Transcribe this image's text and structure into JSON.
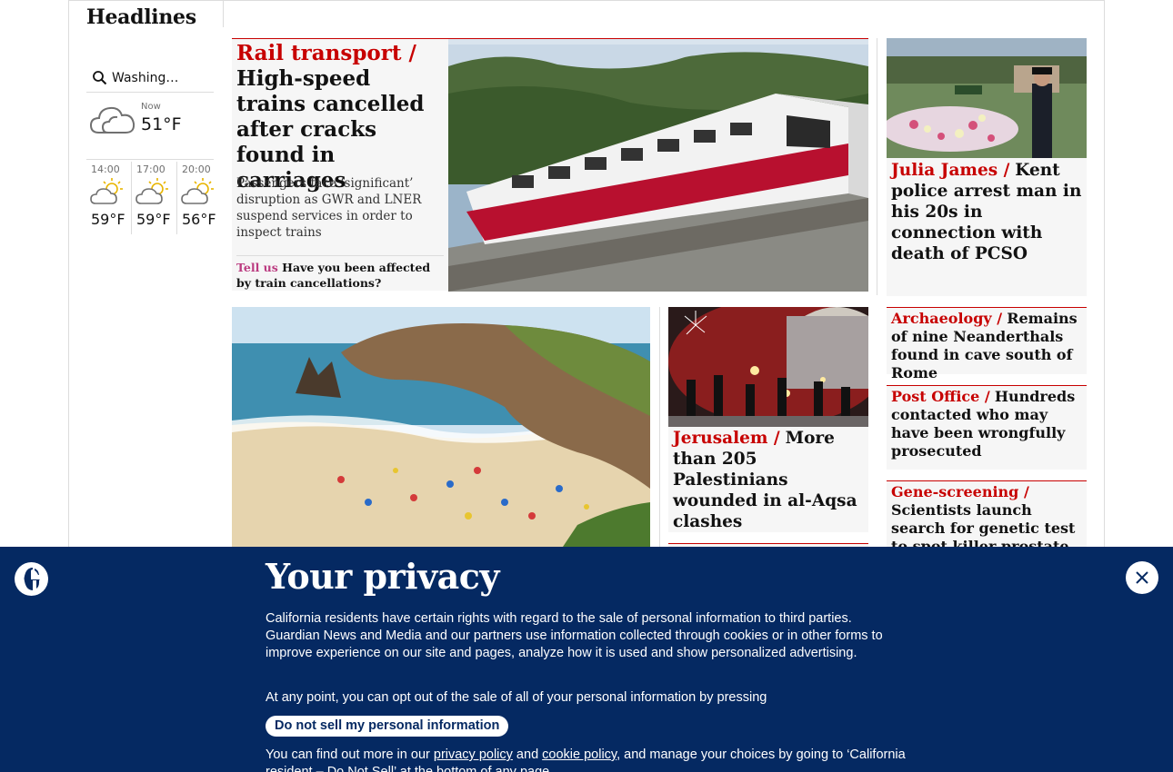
{
  "header": {
    "section_title": "Headlines"
  },
  "weather": {
    "location": "Washing…",
    "now": {
      "label": "Now",
      "temp": "51°F",
      "icon": "cloud-icon"
    },
    "forecast": [
      {
        "time": "14:00",
        "temp": "59°F",
        "icon": "sun-cloud-icon"
      },
      {
        "time": "17:00",
        "temp": "59°F",
        "icon": "sun-cloud-icon"
      },
      {
        "time": "20:00",
        "temp": "56°F",
        "icon": "sun-cloud-icon"
      }
    ]
  },
  "cards": {
    "rail": {
      "kicker": "Rail transport /",
      "headline": "High-speed trains cancelled after cracks found in carriages",
      "standfirst": "Passengers face ‘significant’ disruption as GWR and LNER suspend services in order to inspect trains",
      "tell_us_label": "Tell us",
      "tell_us_text": "Have you been affected by train cancellations?"
    },
    "julia": {
      "kicker": "Julia James /",
      "headline": "Kent police arrest man in his 20s in connection with death of PCSO"
    },
    "archaeology": {
      "kicker": "Archaeology /",
      "headline": "Remains of nine Neanderthals found in cave south of Rome"
    },
    "post_office": {
      "kicker": "Post Office /",
      "headline": "Hundreds contacted who may have been wrongfully prosecuted"
    },
    "gene": {
      "kicker": "Gene-screening /",
      "headline": "Scientists launch search for genetic test to spot killer prostate cancer"
    },
    "jerusalem": {
      "kicker": "Jerusalem /",
      "headline": "More than 205 Palestinians wounded in al-Aqsa clashes"
    }
  },
  "privacy": {
    "title": "Your privacy",
    "paragraph1": "California residents have certain rights with regard to the sale of personal information to third parties. Guardian News and Media and our partners use information collected through cookies or in other forms to improve experience on our site and pages, analyze how it is used and show personalized advertising.",
    "paragraph2": "At any point, you can opt out of the sale of all of your personal information by pressing",
    "button_label": "Do not sell my personal information",
    "p3_prefix": "You can find out more in our ",
    "privacy_policy_link": "privacy policy",
    "p3_and": " and ",
    "cookie_policy_link": "cookie policy",
    "p3_suffix": ", and manage your choices by going to ‘California resident – Do Not Sell’ at the bottom of any page."
  },
  "colors": {
    "news_red": "#c70000",
    "brand_blue": "#052962",
    "tell_us_pink": "#bb3b80",
    "card_bg": "#f6f6f6"
  }
}
